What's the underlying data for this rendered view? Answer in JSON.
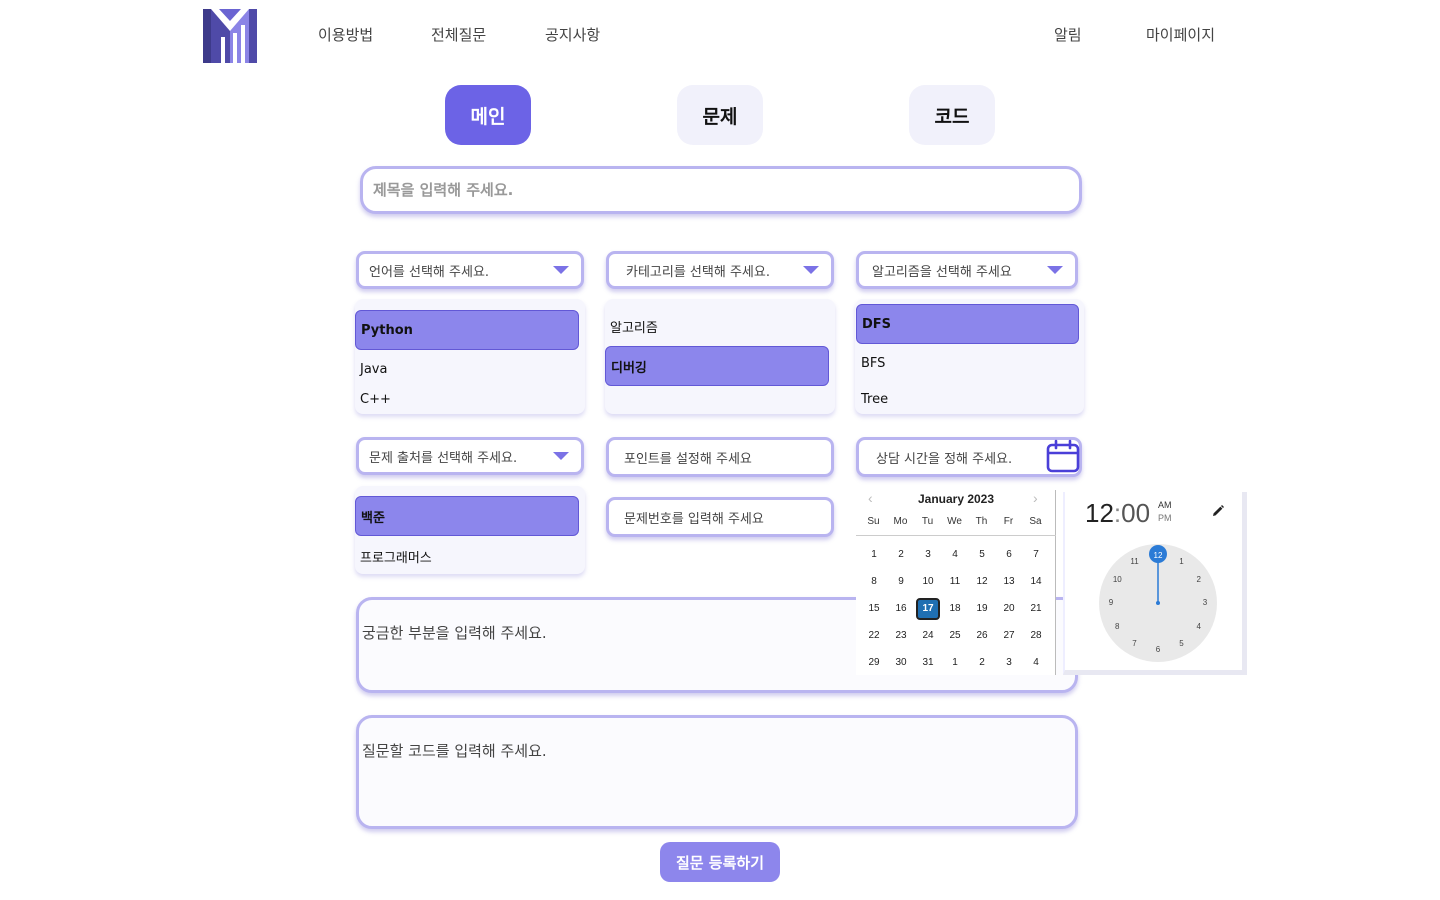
{
  "header": {
    "nav_left": [
      "이용방법",
      "전체질문",
      "공지사항"
    ],
    "nav_right": [
      "알림",
      "마이페이지"
    ]
  },
  "tabs": [
    {
      "label": "메인",
      "active": true
    },
    {
      "label": "문제",
      "active": false
    },
    {
      "label": "코드",
      "active": false
    }
  ],
  "title_input": {
    "placeholder": "제목을 입력해 주세요."
  },
  "language": {
    "placeholder": "언어를 선택해 주세요.",
    "options": [
      "Python",
      "Java",
      "C++"
    ],
    "selected": "Python"
  },
  "category": {
    "placeholder": "카테고리를 선택해 주세요.",
    "options": [
      "알고리즘",
      "디버깅"
    ],
    "selected": "디버깅"
  },
  "algorithm": {
    "placeholder": "알고리즘을 선택해 주세요",
    "options": [
      "DFS",
      "BFS",
      "Tree"
    ],
    "selected": "DFS"
  },
  "source": {
    "placeholder": "문제 출처를 선택해 주세요.",
    "options": [
      "백준",
      "프로그래머스"
    ],
    "selected": "백준"
  },
  "points": {
    "placeholder": "포인트를 설정해 주세요"
  },
  "problem_number": {
    "placeholder": "문제번호를 입력해 주세요"
  },
  "consult_time": {
    "placeholder": "상담 시간을 정해 주세요."
  },
  "question_body": {
    "placeholder": "궁금한 부분을 입력해 주세요."
  },
  "question_code": {
    "placeholder": "질문할 코드를 입력해 주세요."
  },
  "submit_label": "질문 등록하기",
  "calendar": {
    "month_label": "January 2023",
    "weekdays": [
      "Su",
      "Mo",
      "Tu",
      "We",
      "Th",
      "Fr",
      "Sa"
    ],
    "weeks": [
      [
        "1",
        "2",
        "3",
        "4",
        "5",
        "6",
        "7"
      ],
      [
        "8",
        "9",
        "10",
        "11",
        "12",
        "13",
        "14"
      ],
      [
        "15",
        "16",
        "17",
        "18",
        "19",
        "20",
        "21"
      ],
      [
        "22",
        "23",
        "24",
        "25",
        "26",
        "27",
        "28"
      ],
      [
        "29",
        "30",
        "31",
        "1",
        "2",
        "3",
        "4"
      ]
    ],
    "selected_day": "17"
  },
  "time_picker": {
    "hours": "12",
    "sep": ":",
    "minutes": "00",
    "am": "AM",
    "pm": "PM",
    "dial": [
      "12",
      "1",
      "2",
      "3",
      "4",
      "5",
      "6",
      "7",
      "8",
      "9",
      "10",
      "11"
    ],
    "selected_hour": "12"
  },
  "colors": {
    "accent": "#6c63e6",
    "accent_light": "#8c86ec",
    "outline": "#b9b4f0",
    "calendar_today": "#1f6fb2",
    "clock_hand": "#2b7bd6"
  },
  "icons": {
    "logo": "m-logo",
    "calendar": "calendar-icon",
    "edit": "pencil-icon",
    "dropdown": "caret-down-icon"
  }
}
